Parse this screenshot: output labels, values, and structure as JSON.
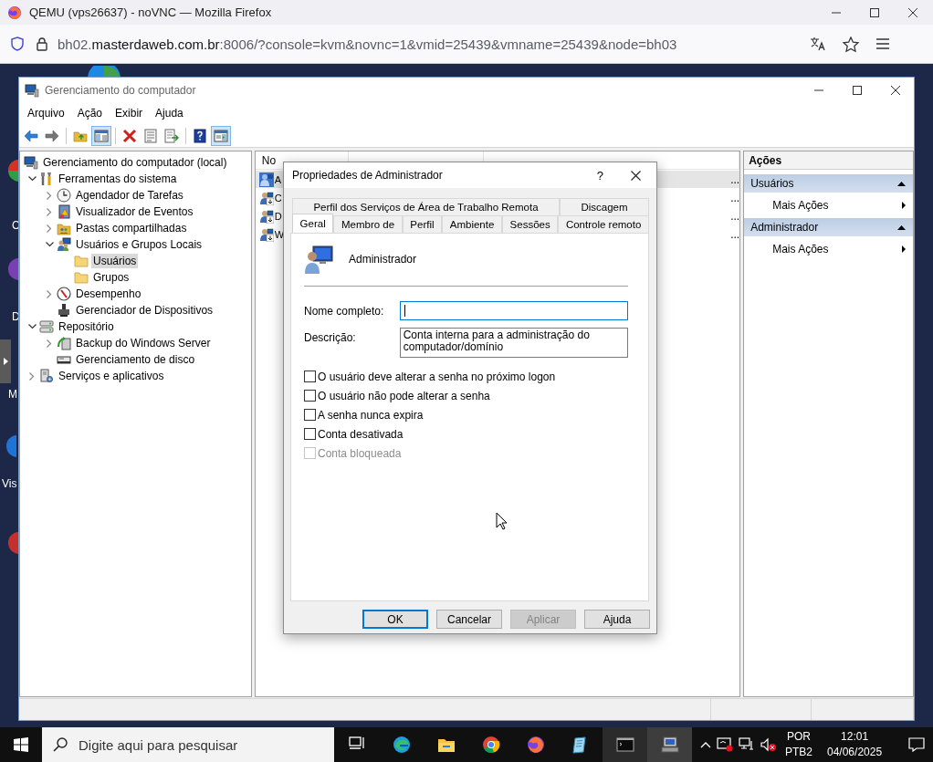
{
  "browser": {
    "title": "QEMU (vps26637) - noVNC — Mozilla Firefox",
    "url": "bh02.**masterdaweb.com.br**:8006/?console=kvm&novnc=1&vmid=25439&vmname=25439&node=bh03"
  },
  "desktop": {
    "icon_labels": [
      "C",
      "D",
      "M",
      "Vis"
    ]
  },
  "window": {
    "title": "Gerenciamento do computador",
    "menu": [
      "Arquivo",
      "Ação",
      "Exibir",
      "Ajuda"
    ],
    "toolbar": [
      [
        {
          "kind": "back",
          "pressed": false
        },
        {
          "kind": "forward",
          "pressed": false
        }
      ],
      [
        {
          "kind": "up",
          "pressed": false
        },
        {
          "kind": "tree",
          "pressed": true
        }
      ],
      [
        {
          "kind": "delete",
          "pressed": false
        },
        {
          "kind": "properties",
          "pressed": false
        },
        {
          "kind": "export",
          "pressed": false
        }
      ],
      [
        {
          "kind": "help",
          "pressed": false
        },
        {
          "kind": "action-pane",
          "pressed": true
        }
      ]
    ]
  },
  "tree": [
    {
      "label": "Gerenciamento do computador (local)",
      "kind": "computer",
      "selected": false,
      "children": [
        {
          "label": "Ferramentas do sistema",
          "kind": "tools",
          "expanded": true,
          "selected": false,
          "children": [
            {
              "label": "Agendador de Tarefas",
              "kind": "clock",
              "expanded": false,
              "selected": false
            },
            {
              "label": "Visualizador de Eventos",
              "kind": "eventlog",
              "expanded": false,
              "selected": false
            },
            {
              "label": "Pastas compartilhadas",
              "kind": "share",
              "expanded": false,
              "selected": false
            },
            {
              "label": "Usuários e Grupos Locais",
              "kind": "users",
              "expanded": true,
              "selected": false,
              "children": [
                {
                  "label": "Usuários",
                  "kind": "folder",
                  "selected": true
                },
                {
                  "label": "Grupos",
                  "kind": "folder",
                  "selected": false
                }
              ]
            },
            {
              "label": "Desempenho",
              "kind": "perf",
              "expanded": false,
              "selected": false
            },
            {
              "label": "Gerenciador de Dispositivos",
              "kind": "device",
              "selected": false
            }
          ]
        },
        {
          "label": "Repositório",
          "kind": "storage",
          "expanded": true,
          "selected": false,
          "children": [
            {
              "label": "Backup do Windows Server",
              "kind": "backup",
              "expanded": false,
              "selected": false
            },
            {
              "label": "Gerenciamento de disco",
              "kind": "disk",
              "selected": false
            }
          ]
        },
        {
          "label": "Serviços e aplicativos",
          "kind": "services",
          "expanded": false,
          "selected": false
        }
      ]
    }
  ],
  "list": {
    "columns": [
      "No"
    ],
    "rows": [
      {
        "name": "A",
        "selected": true,
        "column_3": "..."
      },
      {
        "name": "C",
        "selected": false,
        "column_3": "..."
      },
      {
        "name": "D",
        "selected": false,
        "column_3": "..."
      },
      {
        "name": "W",
        "selected": false,
        "column_3": "..."
      }
    ]
  },
  "actions": {
    "title": "Ações",
    "sections": [
      {
        "title": "Usuários",
        "expanded": true,
        "items": [
          "Mais Ações"
        ]
      },
      {
        "title": "Administrador",
        "expanded": true,
        "items": [
          "Mais Ações"
        ]
      }
    ]
  },
  "dialog": {
    "title": "Propriedades de Administrador",
    "help": "?",
    "tabs": [
      [
        {
          "label": "Perfil dos Serviços de Área de Trabalho Remota",
          "selected": false
        },
        {
          "label": "Discagem",
          "selected": false
        }
      ],
      [
        {
          "label": "Geral",
          "selected": true
        },
        {
          "label": "Membro de",
          "selected": false
        },
        {
          "label": "Perfil",
          "selected": false
        },
        {
          "label": "Ambiente",
          "selected": false
        },
        {
          "label": "Sessões",
          "selected": false
        },
        {
          "label": "Controle remoto",
          "selected": false
        }
      ]
    ],
    "user": "Administrador",
    "fields": [
      {
        "label": "Nome completo:",
        "focused": true,
        "kind": "line"
      },
      {
        "label": "Descrição:",
        "value": "Conta interna para a administração do computador/domínio",
        "focused": false,
        "kind": "box"
      }
    ],
    "checkboxes": [
      {
        "label": "O usuário deve alterar a senha no próximo logon",
        "checked": false,
        "disabled": false
      },
      {
        "label": "O usuário não pode alterar a senha",
        "checked": false,
        "disabled": false
      },
      {
        "label": "A senha nunca expira",
        "checked": false,
        "disabled": false
      },
      {
        "label": "Conta desativada",
        "checked": false,
        "disabled": false
      },
      {
        "label": "Conta bloqueada",
        "checked": false,
        "disabled": true
      }
    ],
    "buttons": [
      {
        "label": "OK",
        "default": true,
        "disabled": false
      },
      {
        "label": "Cancelar",
        "default": false,
        "disabled": false
      },
      {
        "label": "Aplicar",
        "default": false,
        "disabled": true
      },
      {
        "label": "Ajuda",
        "default": false,
        "disabled": false
      }
    ]
  },
  "taskbar": {
    "search_placeholder": "Digite aqui para pesquisar",
    "apps": [
      {
        "kind": "taskview",
        "open": false,
        "focused": false
      },
      {
        "kind": "edge",
        "open": false,
        "focused": false
      },
      {
        "kind": "explorer",
        "open": false,
        "focused": false
      },
      {
        "kind": "chrome",
        "open": false,
        "focused": false
      },
      {
        "kind": "firefox",
        "open": false,
        "focused": false
      },
      {
        "kind": "notepad",
        "open": false,
        "focused": false
      },
      {
        "kind": "terminal",
        "open": true,
        "focused": false
      },
      {
        "kind": "mmc",
        "open": true,
        "focused": true
      }
    ],
    "language": "POR",
    "layout": "PTB2",
    "time": "12:01",
    "date": "04/06/2025"
  }
}
